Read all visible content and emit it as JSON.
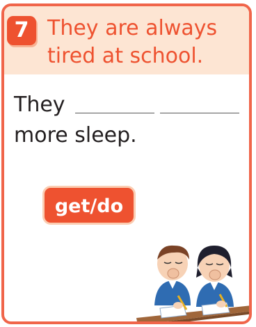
{
  "question": {
    "number": "7",
    "title_lines": [
      "They are always",
      "tired at school."
    ],
    "sentence": {
      "start": "They",
      "end": "more sleep."
    },
    "verb_hint": "get/do"
  },
  "colors": {
    "accent": "#ee5230",
    "header_bg": "#fde5d3",
    "border": "#f0654a"
  },
  "illustration": {
    "icon": "yawning-students-illustration"
  }
}
